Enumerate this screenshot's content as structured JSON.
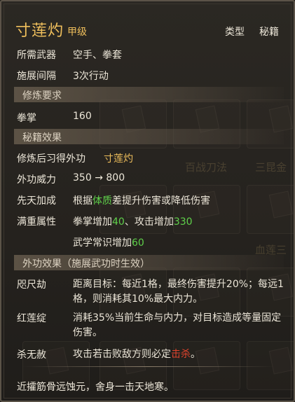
{
  "header": {
    "title": "寸莲灼",
    "grade": "甲级",
    "type_label": "类型",
    "type_value": "秘籍"
  },
  "requirements": [
    {
      "label": "所需武器",
      "value": "空手、拳套"
    },
    {
      "label": "施展间隔",
      "value": "3次行动"
    }
  ],
  "sections": {
    "cultivation": "修炼要求",
    "manual_effect": "秘籍效果",
    "skill_effect": "外功效果（施展武功时生效）"
  },
  "cultivation": {
    "label": "拳掌",
    "value": "160"
  },
  "manual": {
    "learned_label": "修炼后习得外功",
    "learned_value": "寸莲灼",
    "power_label": "外功威力",
    "power_from": "350",
    "power_arrow": "→",
    "power_to": "800",
    "innate_label": "先天加成",
    "innate_pre": "根据",
    "innate_key": "体质",
    "innate_post": "差提升伤害或降低伤害",
    "full_label": "满重属性",
    "full_line1_a": "拳掌增加",
    "full_line1_a_val": "40",
    "full_line1_b": "、攻击增加",
    "full_line1_b_val": "330",
    "full_line2": "武学常识增加",
    "full_line2_val": "60"
  },
  "effects": [
    {
      "name": "咫尺劫",
      "desc": "距离目标：每近1格，最终伤害提升20%；每远1格，则消耗其10%最大内力。"
    },
    {
      "name": "红莲绽",
      "desc": "消耗35%当前生命与内力，对目标造成等量固定伤害。"
    },
    {
      "name": "杀无赦",
      "desc_pre": "攻击若击败敌方则必定",
      "desc_key": "击杀",
      "desc_post": "。"
    }
  ],
  "flavor": "近攉筋骨远蚀元，舍身一击天地寒。",
  "colors": {
    "gold": "#efbf5c",
    "green": "#5fd04a",
    "red": "#e0432d",
    "text": "#ece6d8"
  },
  "background_labels": [
    "百战刀法",
    "三昆金",
    "血莲三"
  ]
}
